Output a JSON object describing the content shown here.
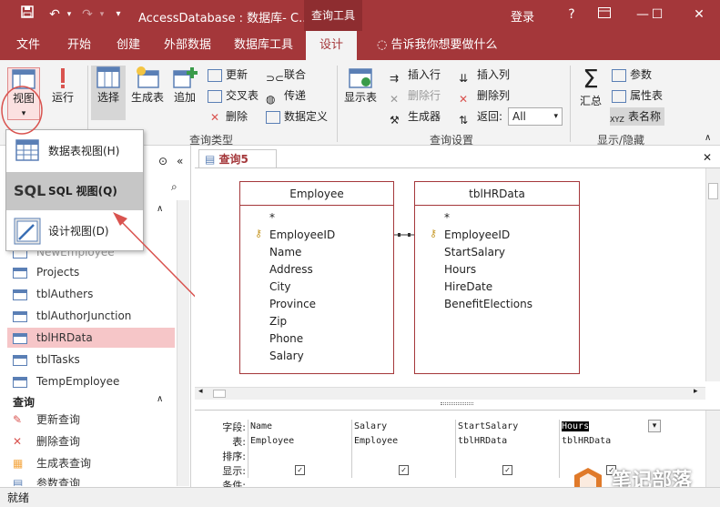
{
  "titlebar": {
    "title": "AccessDatabase : 数据库- C...",
    "context_tab": "查询工具",
    "login": "登录",
    "help": "?",
    "minimize": "—",
    "maximize": "☐",
    "close": "✕"
  },
  "tabs": [
    {
      "label": "文件"
    },
    {
      "label": "开始"
    },
    {
      "label": "创建"
    },
    {
      "label": "外部数据"
    },
    {
      "label": "数据库工具"
    },
    {
      "label": "设计"
    }
  ],
  "tell_me": "告诉我你想要做什么",
  "ribbon": {
    "view": "视图",
    "run": "运行",
    "select": "选择",
    "make_table": "生成表",
    "append": "追加",
    "update": "更新",
    "crosstab": "交叉表",
    "delete": "删除",
    "union": "联合",
    "passthrough": "传递",
    "data_definition": "数据定义",
    "group_query_type": "查询类型",
    "show_table": "显示表",
    "insert_row": "插入行",
    "delete_row": "删除行",
    "builder": "生成器",
    "insert_col": "插入列",
    "delete_col": "删除列",
    "return_label": "返回:",
    "return_value": "All",
    "group_query_setup": "查询设置",
    "totals": "汇总",
    "parameters": "参数",
    "property_sheet": "属性表",
    "table_names": "表名称",
    "group_show_hide": "显示/隐藏"
  },
  "dropdown": {
    "items": [
      {
        "label": "数据表视图(H)"
      },
      {
        "label": "SQL 视图(Q)"
      },
      {
        "label": "设计视图(D)"
      }
    ]
  },
  "navpane": {
    "tables": [
      "NewEmployee",
      "Projects",
      "tblAuthers",
      "tblAuthorJunction",
      "tblHRData",
      "tblTasks",
      "TempEmployee"
    ],
    "queries_header": "查询",
    "queries": [
      "更新查询",
      "删除查询",
      "生成表查询",
      "参数查询"
    ]
  },
  "document": {
    "tab_label": "查询5",
    "tables": [
      {
        "name": "Employee",
        "fields": [
          "*",
          "EmployeeID",
          "Name",
          "Address",
          "City",
          "Province",
          "Zip",
          "Phone",
          "Salary"
        ]
      },
      {
        "name": "tblHRData",
        "fields": [
          "*",
          "EmployeeID",
          "StartSalary",
          "Hours",
          "HireDate",
          "BenefitElections"
        ]
      }
    ]
  },
  "grid": {
    "row_labels": [
      "字段:",
      "表:",
      "排序:",
      "显示:",
      "条件:"
    ],
    "columns": [
      {
        "field": "Name",
        "table": "Employee"
      },
      {
        "field": "Salary",
        "table": "Employee"
      },
      {
        "field": "StartSalary",
        "table": "tblHRData"
      },
      {
        "field": "Hours",
        "table": "tblHRData"
      }
    ]
  },
  "status": "就绪",
  "watermark": "笔记部落",
  "colors": {
    "accent": "#a4373a",
    "arrow": "#d9534f",
    "highlight": "#f6c6c8"
  }
}
